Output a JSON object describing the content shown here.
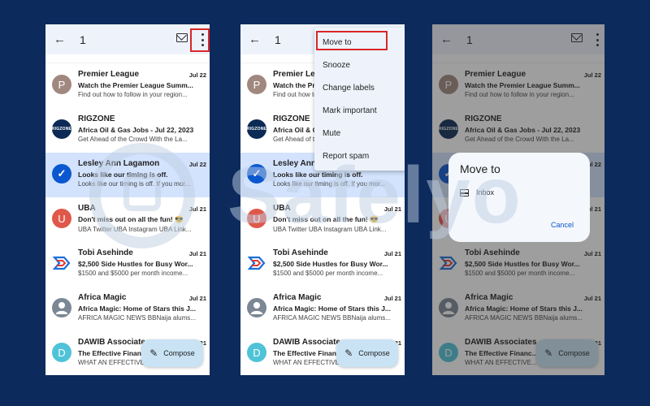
{
  "header": {
    "back_glyph": "←",
    "count": "1"
  },
  "emails": [
    {
      "avatar_letter": "P",
      "avatar_color": "#a1887f",
      "avatar_kind": "letter",
      "sender": "Premier League",
      "date": "Jul 22",
      "subject": "Watch the Premier League Summ...",
      "snippet": "Find out how to follow in your region..."
    },
    {
      "avatar_letter": "RIGZONE",
      "avatar_color": "#0b2a55",
      "avatar_kind": "rig",
      "sender": "RIGZONE",
      "date": "",
      "subject": "Africa Oil & Gas Jobs - Jul 22, 2023",
      "snippet": "Get Ahead of the Crowd With the La..."
    },
    {
      "avatar_letter": "✓",
      "avatar_color": "#0b57d0",
      "avatar_kind": "check",
      "sender": "Lesley Ann Lagamon",
      "date": "Jul 22",
      "subject": "Looks like our timing is off.",
      "snippet": "Looks like our timing is off. If you mor...",
      "selected": true
    },
    {
      "avatar_letter": "U",
      "avatar_color": "#e0584a",
      "avatar_kind": "letter",
      "sender": "UBA",
      "date": "Jul 21",
      "subject": "Don't miss out on all the fun! 😎",
      "snippet": "UBA Twitter UBA Instagram UBA Link..."
    },
    {
      "avatar_letter": "",
      "avatar_color": "#1e6fd9",
      "avatar_kind": "tobi",
      "sender": "Tobi Asehinde",
      "date": "Jul 21",
      "subject": "$2,500 Side Hustles for Busy Wor...",
      "snippet": "$1500 and $5000 per month income..."
    },
    {
      "avatar_letter": "",
      "avatar_color": "#7b8794",
      "avatar_kind": "person",
      "sender": "Africa Magic",
      "date": "Jul 21",
      "subject": "Africa Magic: Home of Stars this J...",
      "snippet": "AFRICA MAGIC NEWS BBNaija alums..."
    },
    {
      "avatar_letter": "D",
      "avatar_color": "#4fc3d7",
      "avatar_kind": "letter",
      "sender": "DAWIB Associates",
      "date": "Jul 21",
      "subject": "The Effective Financ...",
      "snippet": "WHAT AN EFFECTIVE..."
    }
  ],
  "compose_label": "Compose",
  "menu": {
    "items": [
      "Move to",
      "Snooze",
      "Change labels",
      "Mark important",
      "Mute",
      "Report spam"
    ]
  },
  "dialog": {
    "title": "Move to",
    "option_label": "Inbox",
    "cancel_label": "Cancel"
  },
  "watermark": "Safelyo",
  "colors": {
    "background": "#0d2a5c",
    "highlight": "#d9262a",
    "selected_row": "#d3e3fd",
    "accent": "#0b57d0"
  }
}
